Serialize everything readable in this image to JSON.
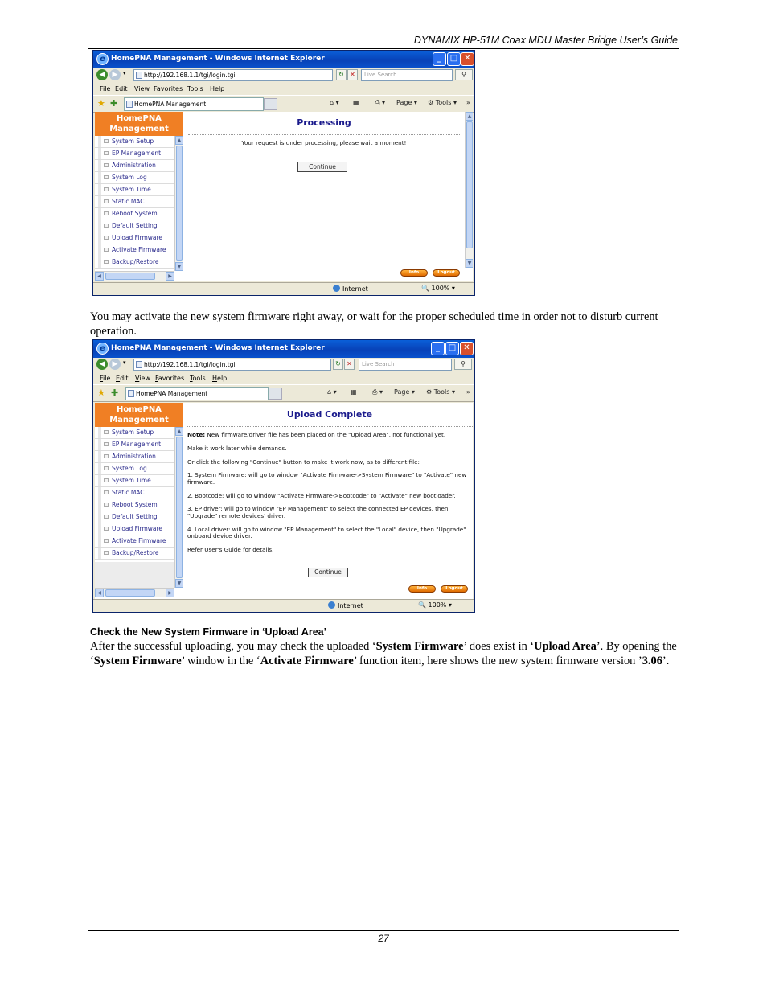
{
  "header": "DYNAMIX HP-51M Coax MDU Master Bridge User’s Guide",
  "page_number": "27",
  "paragraph1": "You may activate the new system firmware right away, or wait for the proper scheduled time in order not to disturb current operation.",
  "section_heading": "Check the New System Firmware in ‘Upload Area’",
  "paragraph2": {
    "p1": "After the successful uploading, you may check the uploaded ‘",
    "b1": "System Firmware",
    "p2": "’ does exist in ‘",
    "b2": "Upload Area",
    "p3": "’. By opening the ‘",
    "b3": "System Firmware",
    "p4": "’ window in the ‘",
    "b4": "Activate Firmware",
    "p5": "’ function item, here shows the new system firmware version ’",
    "b5": "3.06",
    "p6": "’."
  },
  "browser": {
    "title": "HomePNA Management - Windows Internet Explorer",
    "url": "http://192.168.1.1/tgi/login.tgi",
    "search_placeholder": "Live Search",
    "menu": [
      "File",
      "Edit",
      "View",
      "Favorites",
      "Tools",
      "Help"
    ],
    "tab": "HomePNA Management",
    "page_tool": "Page",
    "tools_tool": "Tools",
    "status_zone": "Internet",
    "zoom": "100%"
  },
  "sidebar": {
    "title_line1": "HomePNA",
    "title_line2": "Management",
    "items": [
      "System Setup",
      "EP Management",
      "Administration",
      "System Log",
      "System Time",
      "Static MAC",
      "Reboot System",
      "Default Setting",
      "Upload Firmware",
      "Activate Firmware",
      "Backup/Restore"
    ]
  },
  "screen1": {
    "title": "Processing",
    "message": "Your request is under processing, please wait a moment!",
    "button": "Continue"
  },
  "screen2": {
    "title": "Upload Complete",
    "note_label": "Note:",
    "note_text": " New firmware/driver file has been placed on the \"Upload Area\", not functional yet.",
    "lines": [
      "Make it work later while demands.",
      "Or click the following \"Continue\" button to make it work now, as to different file:",
      "1. System Firmware: will go to window \"Activate Firmware->System Firmware\" to \"Activate\" new firmware.",
      "2. Bootcode: will go to window \"Activate Firmware->Bootcode\" to \"Activate\" new bootloader.",
      "3. EP driver: will go to window \"EP Management\" to select the connected EP devices, then \"Upgrade\" remote devices' driver.",
      "4. Local driver: will go to window \"EP Management\" to select the \"Local\" device, then \"Upgrade\" onboard device driver.",
      "Refer User's Guide for details."
    ],
    "button": "Continue"
  },
  "footer_buttons": {
    "info": "Info",
    "logout": "Logout"
  }
}
